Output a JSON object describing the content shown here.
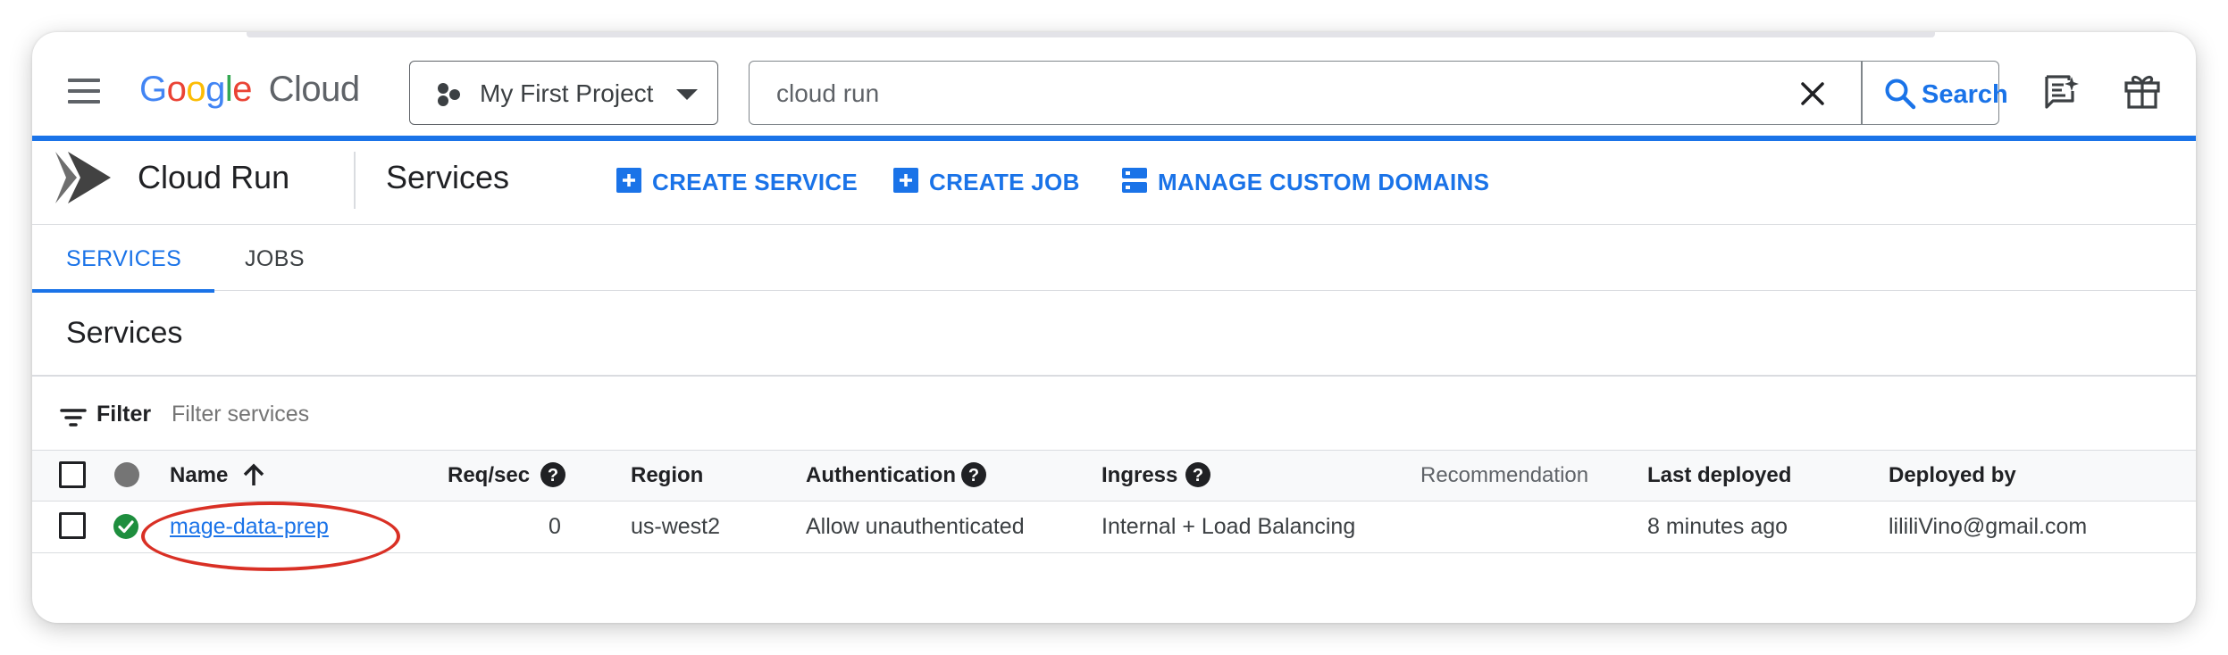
{
  "header": {
    "logo_google_letters": [
      "G",
      "o",
      "o",
      "g",
      "l",
      "e"
    ],
    "logo_google_colors": [
      "#4285F4",
      "#EA4335",
      "#FBBC05",
      "#4285F4",
      "#34A853",
      "#EA4335"
    ],
    "logo_cloud": "Cloud",
    "project_name": "My First Project",
    "search_value": "cloud run",
    "search_button": "Search"
  },
  "product_bar": {
    "product_name": "Cloud Run",
    "page_title": "Services",
    "actions": [
      {
        "label": "CREATE SERVICE",
        "icon": "add-box-icon"
      },
      {
        "label": "CREATE JOB",
        "icon": "add-box-icon"
      },
      {
        "label": "MANAGE CUSTOM DOMAINS",
        "icon": "domains-icon"
      }
    ]
  },
  "tabs": [
    {
      "label": "SERVICES",
      "active": true
    },
    {
      "label": "JOBS",
      "active": false
    }
  ],
  "section_title": "Services",
  "filter": {
    "label": "Filter",
    "placeholder": "Filter services"
  },
  "table": {
    "columns": {
      "name": "Name",
      "req_sec": "Req/sec",
      "region": "Region",
      "authentication": "Authentication",
      "ingress": "Ingress",
      "recommendation": "Recommendation",
      "last_deployed": "Last deployed",
      "deployed_by": "Deployed by"
    },
    "rows": [
      {
        "status": "ok",
        "name": "mage-data-prep",
        "req_sec": "0",
        "region": "us-west2",
        "authentication": "Allow unauthenticated",
        "ingress": "Internal + Load Balancing",
        "recommendation": "",
        "last_deployed": "8 minutes ago",
        "deployed_by": "lililiVino@gmail.com"
      }
    ]
  },
  "colors": {
    "accent": "#1a73e8",
    "success": "#1e8e3e",
    "annotation": "#d93025"
  }
}
